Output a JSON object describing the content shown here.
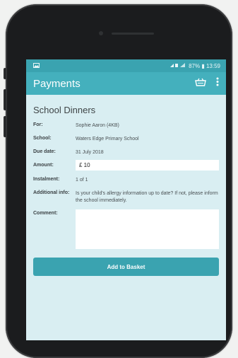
{
  "statusbar": {
    "left_icon": "image-icon",
    "right_text": "87% ▮ 13:59"
  },
  "appbar": {
    "title": "Payments",
    "basket_icon": "basket-icon",
    "menu_icon": "more-vert-icon"
  },
  "payment": {
    "title": "School Dinners",
    "for_label": "For:",
    "for_value": "Sophie Aaron (4KB)",
    "school_label": "School:",
    "school_value": "Waters Edge Primary School",
    "due_label": "Due date:",
    "due_value": "31 July 2018",
    "amount_label": "Amount:",
    "amount_value": "£ 10",
    "instalment_label": "Instalment:",
    "instalment_value": "1 of 1",
    "info_label": "Additional info:",
    "info_value": "Is your child's allergy information up to date? If not, please inform the school immediately.",
    "comment_label": "Comment:",
    "comment_value": "",
    "add_button": "Add to Basket"
  },
  "colors": {
    "appbar": "#44b0bd",
    "statusbar": "#3aa3b0",
    "background": "#d9eef2"
  }
}
